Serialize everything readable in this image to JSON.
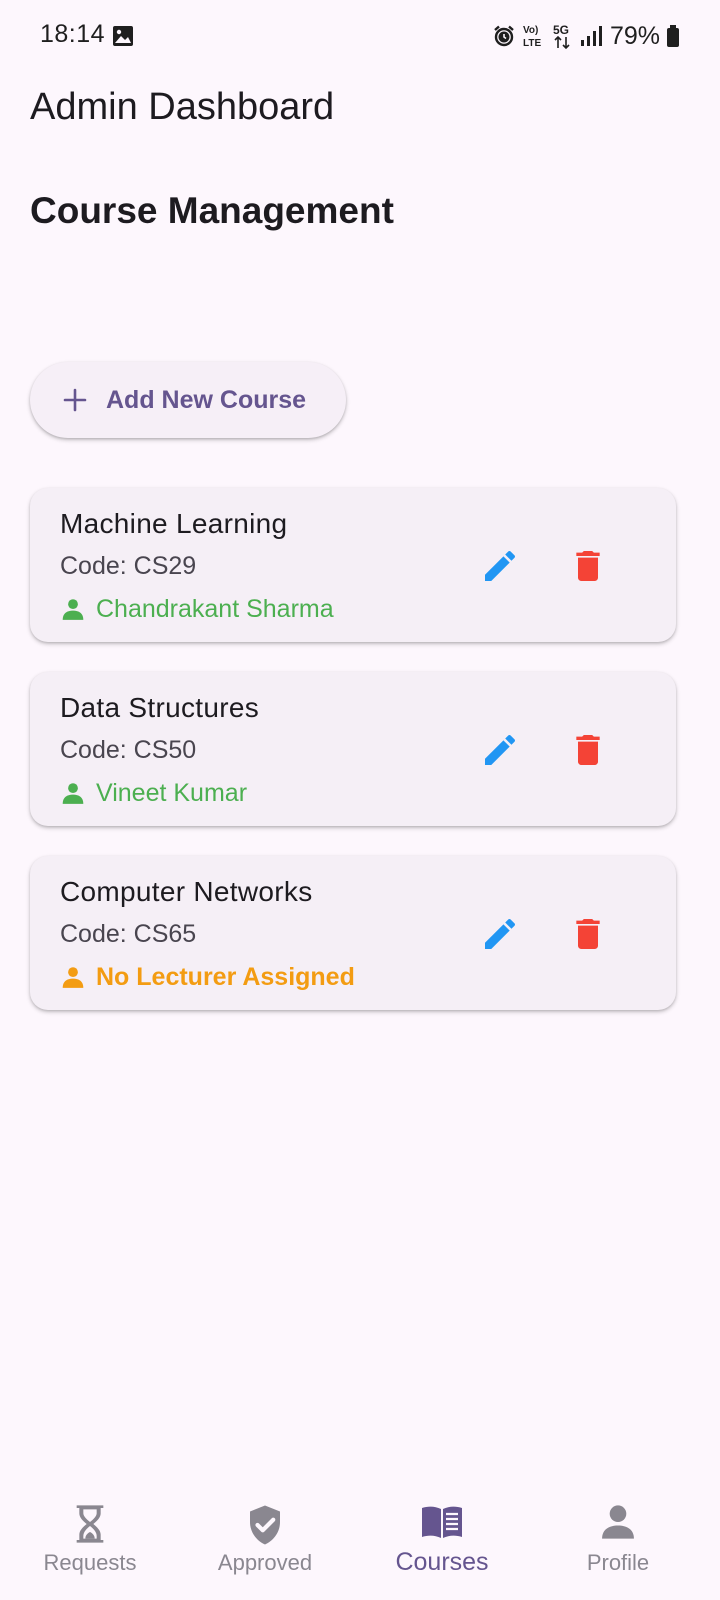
{
  "status_bar": {
    "time": "18:14",
    "battery": "79%",
    "network_volte": "Vo) LTE",
    "network_5g": "5G"
  },
  "header": {
    "app_title": "Admin Dashboard",
    "section_title": "Course Management"
  },
  "actions": {
    "add_course_label": "Add New Course"
  },
  "courses": [
    {
      "name": "Machine Learning",
      "code": "Code: CS29",
      "lecturer": "Chandrakant Sharma",
      "assigned": true
    },
    {
      "name": "Data Structures",
      "code": "Code: CS50",
      "lecturer": "Vineet Kumar",
      "assigned": true
    },
    {
      "name": "Computer Networks",
      "code": "Code: CS65",
      "lecturer": "No Lecturer Assigned",
      "assigned": false
    }
  ],
  "bottom_nav": {
    "items": [
      {
        "label": "Requests",
        "icon": "hourglass-icon",
        "active": false
      },
      {
        "label": "Approved",
        "icon": "shield-check-icon",
        "active": false
      },
      {
        "label": "Courses",
        "icon": "book-icon",
        "active": true
      },
      {
        "label": "Profile",
        "icon": "person-icon",
        "active": false
      }
    ]
  },
  "colors": {
    "background": "#fdf7fd",
    "card": "#f5eff6",
    "accent": "#65558f",
    "edit": "#2196f3",
    "delete": "#f44336",
    "assigned": "#4caf50",
    "unassigned": "#f39c12",
    "nav_inactive": "#8a8790"
  }
}
